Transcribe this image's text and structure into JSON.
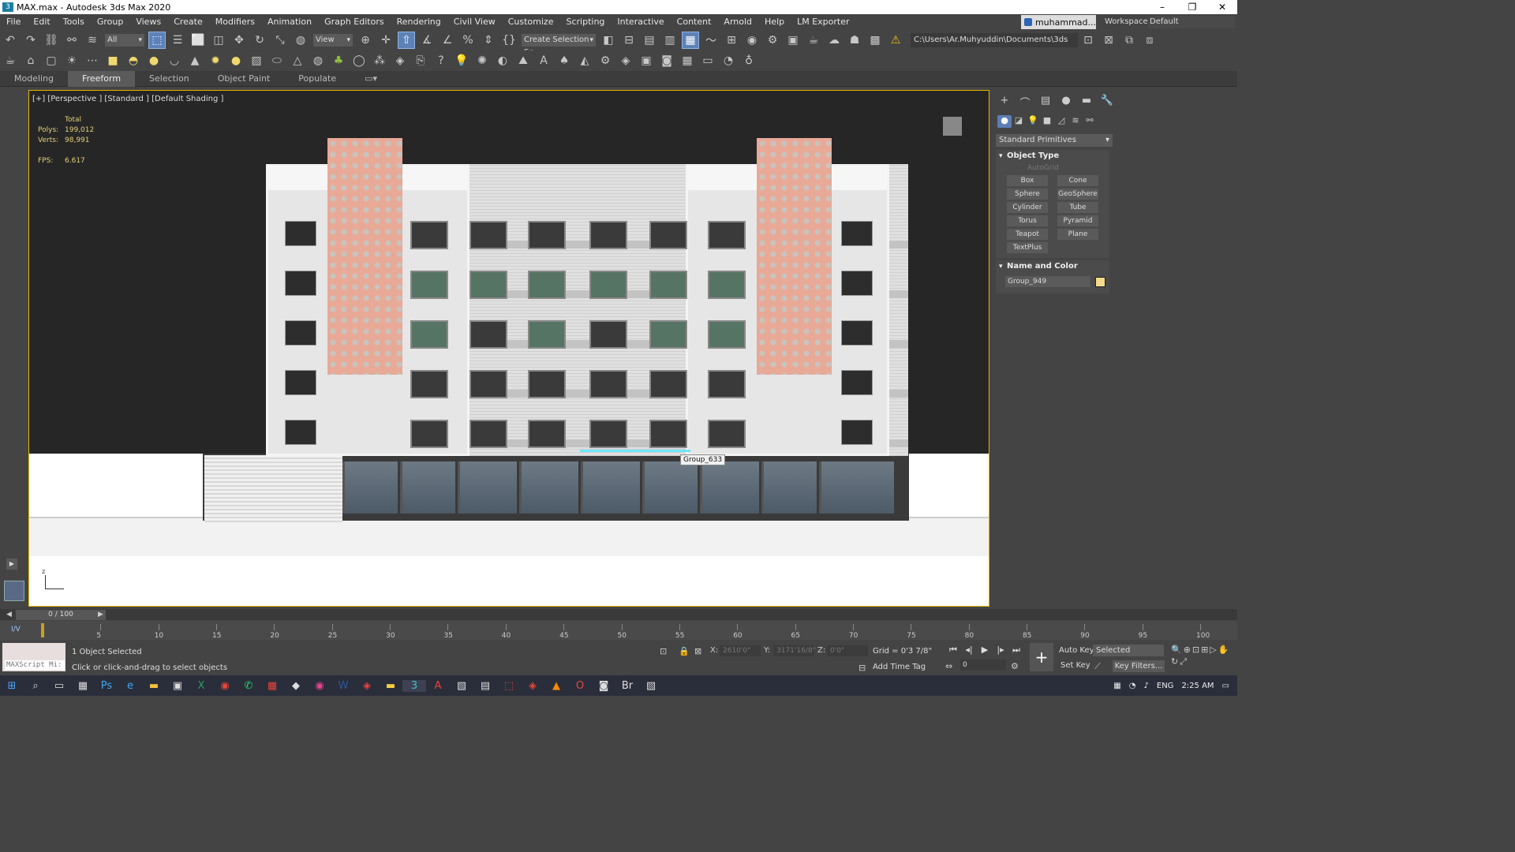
{
  "window": {
    "title": "MAX.max - Autodesk 3ds Max 2020",
    "logo_text": "3",
    "minimize": "–",
    "maximize": "❐",
    "close": "✕"
  },
  "menu": [
    "File",
    "Edit",
    "Tools",
    "Group",
    "Views",
    "Create",
    "Modifiers",
    "Animation",
    "Graph Editors",
    "Rendering",
    "Civil View",
    "Customize",
    "Scripting",
    "Interactive",
    "Content",
    "Arnold",
    "Help",
    "LM Exporter"
  ],
  "user": {
    "name": "muhammad..."
  },
  "workspace": {
    "label": "Workspaces:",
    "value": "Default"
  },
  "toolbar": {
    "filter": "All",
    "view": "View",
    "selection_set": "Create Selection Se",
    "project_path": "C:\\Users\\Ar.Muhyuddin\\Documents\\3ds Max 2020"
  },
  "ribbon_tabs": [
    "Modeling",
    "Freeform",
    "Selection",
    "Object Paint",
    "Populate"
  ],
  "viewport": {
    "label": "[+] [Perspective ] [Standard ] [Default Shading ]",
    "stats_header": "Total",
    "polys_label": "Polys:",
    "polys": "199,012",
    "verts_label": "Verts:",
    "verts": "98,991",
    "fps_label": "FPS:",
    "fps": "6.617",
    "tooltip": "Group_633",
    "axis": "z"
  },
  "command_panel": {
    "category": "Standard Primitives",
    "object_type_title": "Object Type",
    "autogrid": "AutoGrid",
    "buttons": [
      "Box",
      "Cone",
      "Sphere",
      "GeoSphere",
      "Cylinder",
      "Tube",
      "Torus",
      "Pyramid",
      "Teapot",
      "Plane",
      "TextPlus"
    ],
    "name_color_title": "Name and Color",
    "object_name": "Group_949",
    "object_color": "#f2da8a"
  },
  "timeline": {
    "frames": "0 / 100",
    "ticks": [
      "5",
      "10",
      "15",
      "20",
      "25",
      "30",
      "35",
      "40",
      "45",
      "50",
      "55",
      "60",
      "65",
      "70",
      "75",
      "80",
      "85",
      "90",
      "95",
      "100"
    ]
  },
  "status": {
    "maxscript": "MAXScript Mi:",
    "selected": "1 Object Selected",
    "prompt": "Click or click-and-drag to select objects",
    "x_label": "X:",
    "x": "2610'0\"",
    "y_label": "Y:",
    "y": "3171'16/8\"",
    "z_label": "Z:",
    "z": "0'0\"",
    "grid": "Grid = 0'3 7/8\"",
    "add_time_tag": "Add Time Tag",
    "auto_key": "Auto Key",
    "set_key": "Set Key",
    "key_mode": "Selected",
    "key_filters": "Key Filters...",
    "current_frame": "0"
  },
  "taskbar": {
    "lang": "ENG",
    "time": "2:25 AM"
  }
}
